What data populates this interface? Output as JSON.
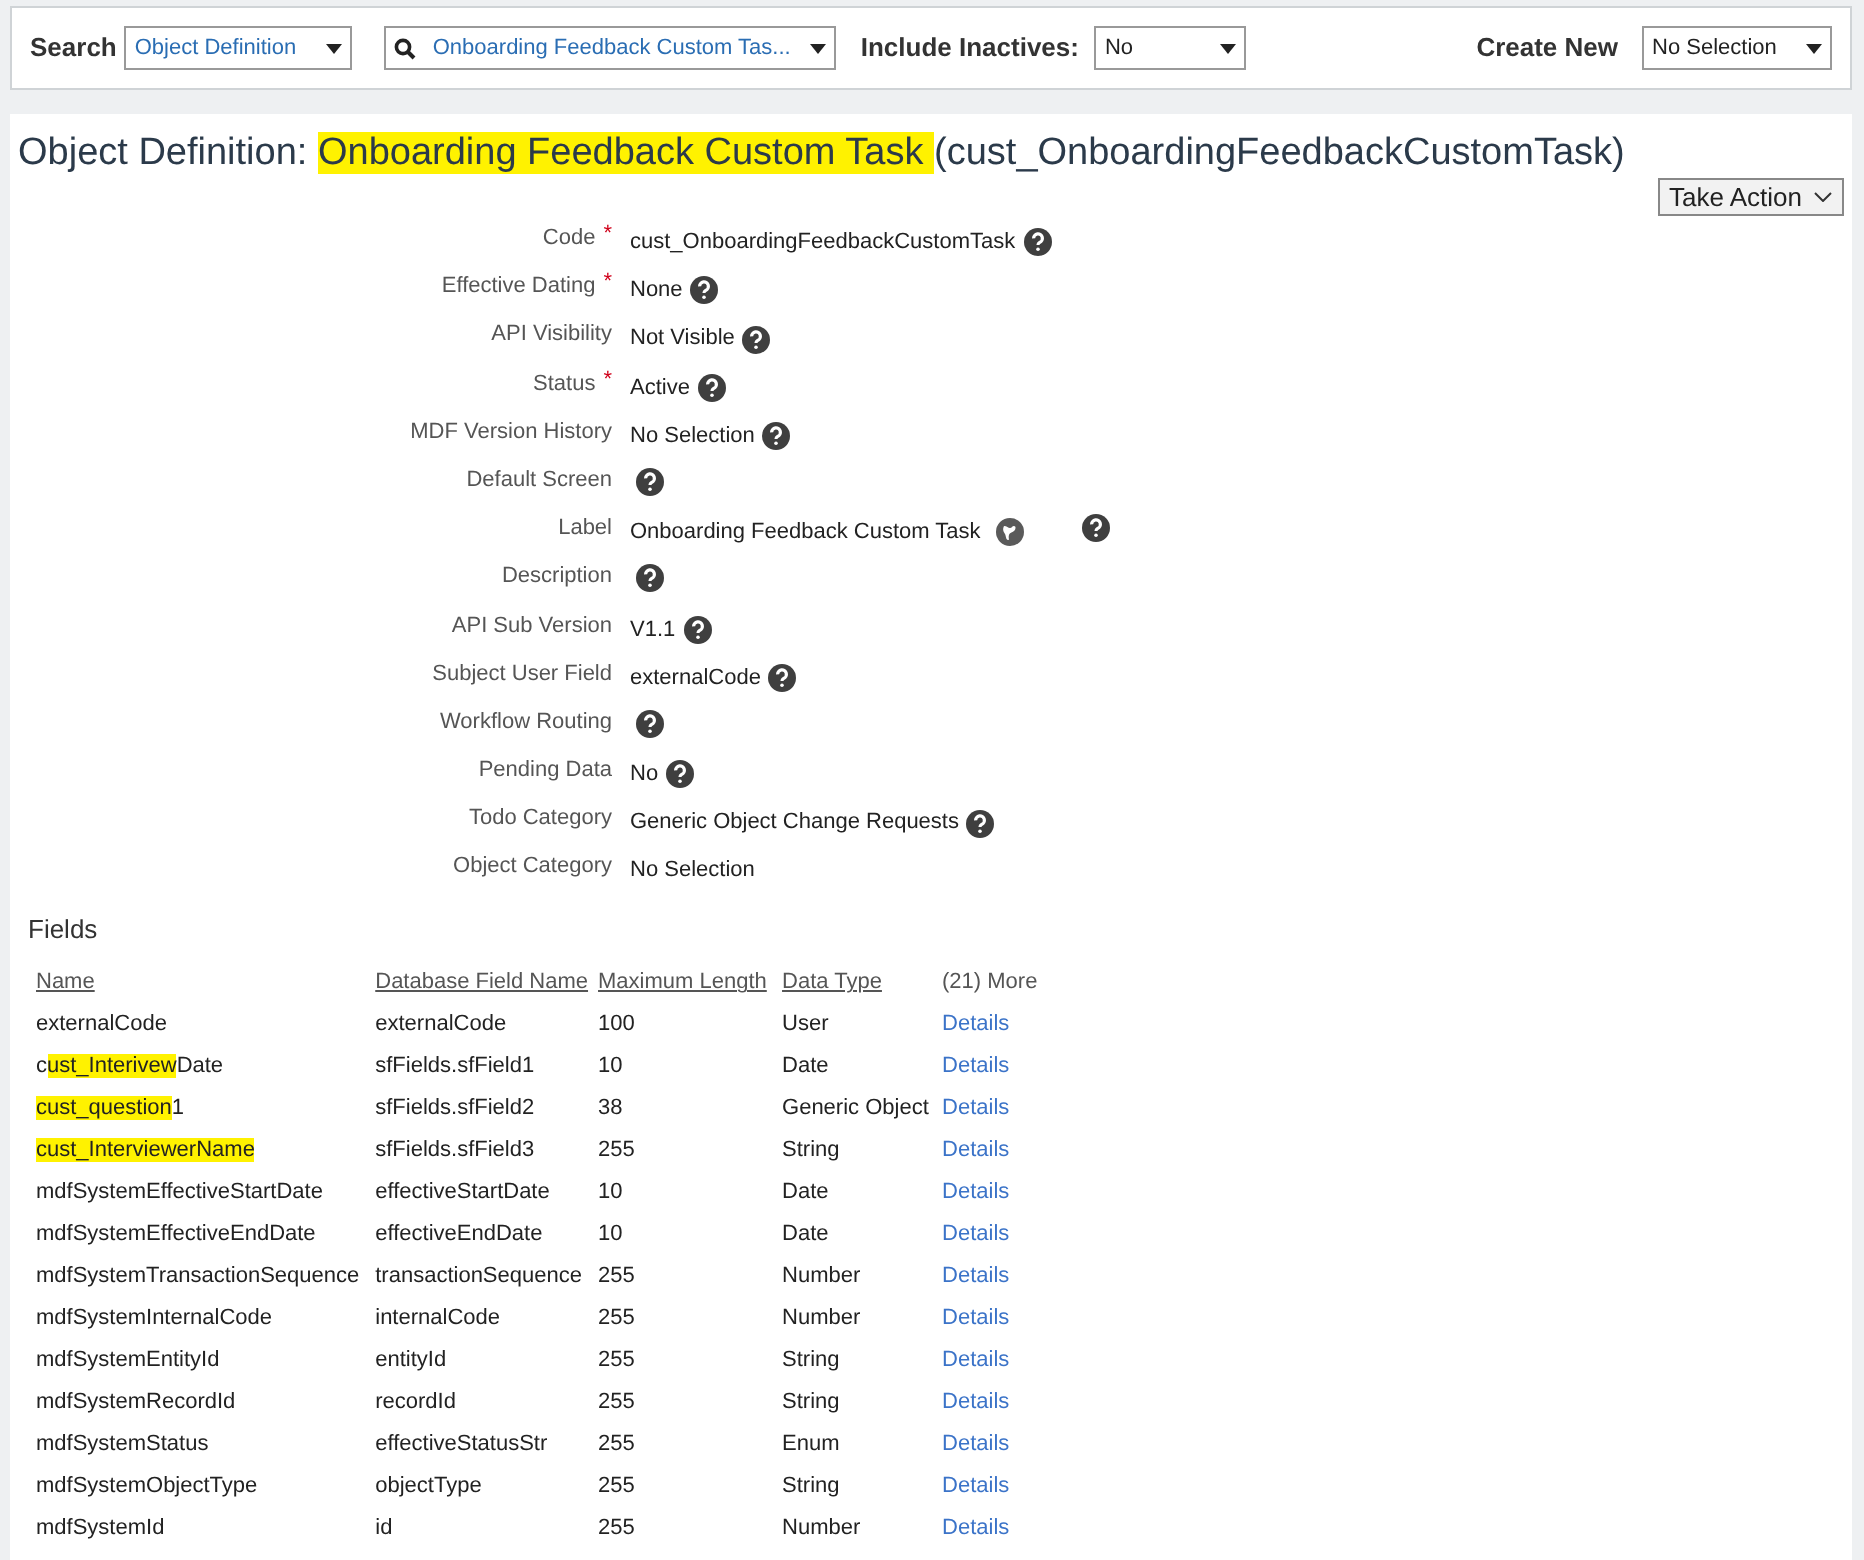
{
  "search_bar": {
    "search_label": "Search",
    "type_select": "Object Definition",
    "object_select": "Onboarding Feedback Custom Tas...",
    "inactives_label": "Include Inactives:",
    "inactives_select": "No",
    "create_label": "Create New",
    "create_select": "No Selection"
  },
  "title_parts": [
    {
      "text": "Object Definition: ",
      "highlighted": false
    },
    {
      "text": "Onboarding Feedback Custom Task ",
      "highlighted": true
    },
    {
      "text": "(cust_OnboardingFeedbackCustomTask)",
      "highlighted": false
    }
  ],
  "take_action": "Take Action",
  "properties": [
    {
      "label": "Code",
      "required_mark": "*",
      "value": "cust_OnboardingFeedbackCustomTask",
      "help": true,
      "translate": false
    },
    {
      "label": "Effective Dating",
      "required_mark": "*",
      "value": "None",
      "help": true,
      "translate": false
    },
    {
      "label": "API Visibility",
      "value": "Not Visible",
      "help": true,
      "translate": false
    },
    {
      "label": "Status",
      "required_mark": "*",
      "value": "Active",
      "help": true,
      "translate": false
    },
    {
      "label": "MDF Version History",
      "value": "No Selection",
      "help": true,
      "translate": false
    },
    {
      "label": "Default Screen",
      "help": true,
      "translate": false
    },
    {
      "label": "Label",
      "value": "Onboarding Feedback Custom Task",
      "help": true,
      "translate": true
    },
    {
      "label": "Description",
      "help": true,
      "translate": false
    },
    {
      "label": "API Sub Version",
      "value": "V1.1",
      "help": true,
      "translate": false
    },
    {
      "label": "Subject User Field",
      "value": "externalCode",
      "help": true,
      "translate": false
    },
    {
      "label": "Workflow Routing",
      "help": true,
      "translate": false
    },
    {
      "label": "Pending Data",
      "value": "No",
      "help": true,
      "translate": false
    },
    {
      "label": "Todo Category",
      "value": "Generic Object Change Requests",
      "help": true,
      "translate": false
    },
    {
      "label": "Object Category",
      "value": "No Selection",
      "help": false,
      "translate": false
    }
  ],
  "fields": {
    "title": "Fields",
    "columns": [
      "Name",
      "Database Field Name",
      "Maximum Length",
      "Data Type"
    ],
    "more": "(21) More",
    "rows": [
      {
        "name": [
          {
            "text": "externalCode",
            "highlighted": false
          }
        ],
        "db": "externalCode",
        "length": "100",
        "type": "User",
        "link": "Details"
      },
      {
        "name": [
          {
            "text": "c",
            "highlighted": false
          },
          {
            "text": "ust_Interivew",
            "highlighted": true
          },
          {
            "text": "Date",
            "highlighted": false
          }
        ],
        "db": "sfFields.sfField1",
        "length": "10",
        "type": "Date",
        "link": "Details"
      },
      {
        "name": [
          {
            "text": "cust_question",
            "highlighted": true
          },
          {
            "text": "1",
            "highlighted": false
          }
        ],
        "db": "sfFields.sfField2",
        "length": "38",
        "type": "Generic Object",
        "link": "Details"
      },
      {
        "name": [
          {
            "text": "cust_InterviewerName",
            "highlighted": true
          }
        ],
        "db": "sfFields.sfField3",
        "length": "255",
        "type": "String",
        "link": "Details"
      },
      {
        "name": [
          {
            "text": "mdfSystemEffectiveStartDate",
            "highlighted": false
          }
        ],
        "db": "effectiveStartDate",
        "length": "10",
        "type": "Date",
        "link": "Details"
      },
      {
        "name": [
          {
            "text": "mdfSystemEffectiveEndDate",
            "highlighted": false
          }
        ],
        "db": "effectiveEndDate",
        "length": "10",
        "type": "Date",
        "link": "Details"
      },
      {
        "name": [
          {
            "text": "mdfSystemTransactionSequence",
            "highlighted": false
          }
        ],
        "db": "transactionSequence",
        "length": "255",
        "type": "Number",
        "link": "Details"
      },
      {
        "name": [
          {
            "text": "mdfSystemInternalCode",
            "highlighted": false
          }
        ],
        "db": "internalCode",
        "length": "255",
        "type": "Number",
        "link": "Details"
      },
      {
        "name": [
          {
            "text": "mdfSystemEntityId",
            "highlighted": false
          }
        ],
        "db": "entityId",
        "length": "255",
        "type": "String",
        "link": "Details"
      },
      {
        "name": [
          {
            "text": "mdfSystemRecordId",
            "highlighted": false
          }
        ],
        "db": "recordId",
        "length": "255",
        "type": "String",
        "link": "Details"
      },
      {
        "name": [
          {
            "text": "mdfSystemStatus",
            "highlighted": false
          }
        ],
        "db": "effectiveStatusStr",
        "length": "255",
        "type": "Enum",
        "link": "Details"
      },
      {
        "name": [
          {
            "text": "mdfSystemObjectType",
            "highlighted": false
          }
        ],
        "db": "objectType",
        "length": "255",
        "type": "String",
        "link": "Details"
      },
      {
        "name": [
          {
            "text": "mdfSystemId",
            "highlighted": false
          }
        ],
        "db": "id",
        "length": "255",
        "type": "Number",
        "link": "Details"
      }
    ]
  }
}
